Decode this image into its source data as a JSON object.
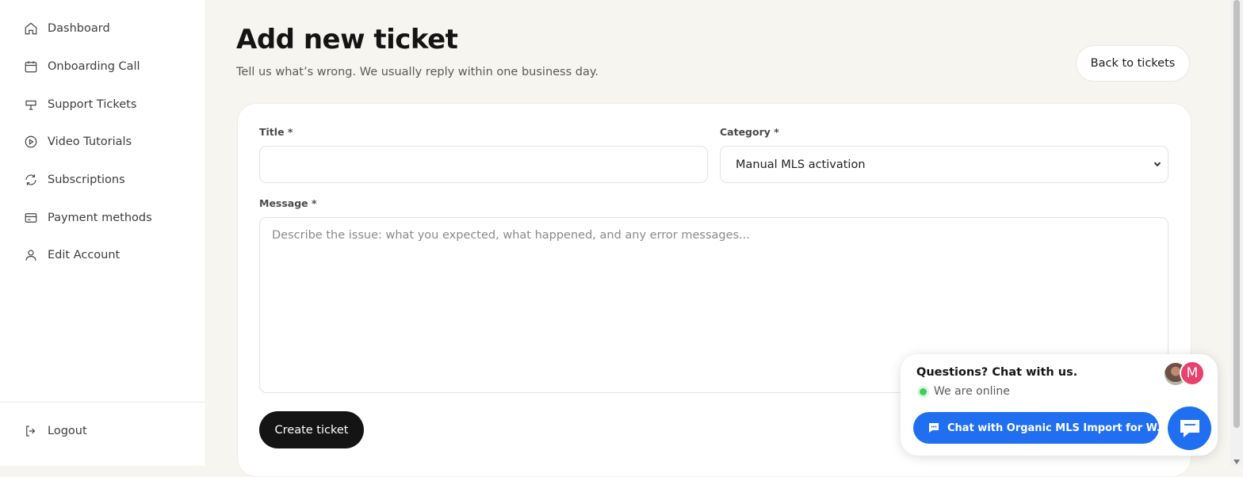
{
  "sidebar": {
    "items": [
      {
        "label": "Dashboard",
        "icon": "home-icon"
      },
      {
        "label": "Onboarding Call",
        "icon": "calendar-icon"
      },
      {
        "label": "Support Tickets",
        "icon": "sign-icon"
      },
      {
        "label": "Video Tutorials",
        "icon": "play-circle-icon"
      },
      {
        "label": "Subscriptions",
        "icon": "refresh-icon"
      },
      {
        "label": "Payment methods",
        "icon": "credit-card-icon"
      },
      {
        "label": "Edit Account",
        "icon": "user-icon"
      }
    ],
    "logout": {
      "label": "Logout",
      "icon": "logout-icon"
    }
  },
  "page": {
    "title": "Add new ticket",
    "subtitle": "Tell us what’s wrong. We usually reply within one business day.",
    "back_button": "Back to tickets"
  },
  "form": {
    "title_label": "Title *",
    "title_value": "",
    "category_label": "Category *",
    "category_value": "Manual MLS activation",
    "message_label": "Message *",
    "message_placeholder": "Describe the issue: what you expected, what happened, and any error messages...",
    "submit_label": "Create ticket"
  },
  "chat": {
    "title": "Questions? Chat with us.",
    "status": "We are online",
    "cta": "Chat with Organic MLS Import for W...",
    "avatar_initial": "M",
    "colors": {
      "accent": "#1f6ff0",
      "online": "#3ecf5a",
      "avatar": "#e8416c"
    }
  },
  "colors": {
    "background": "#f7f5f0",
    "primary_button": "#141414"
  }
}
